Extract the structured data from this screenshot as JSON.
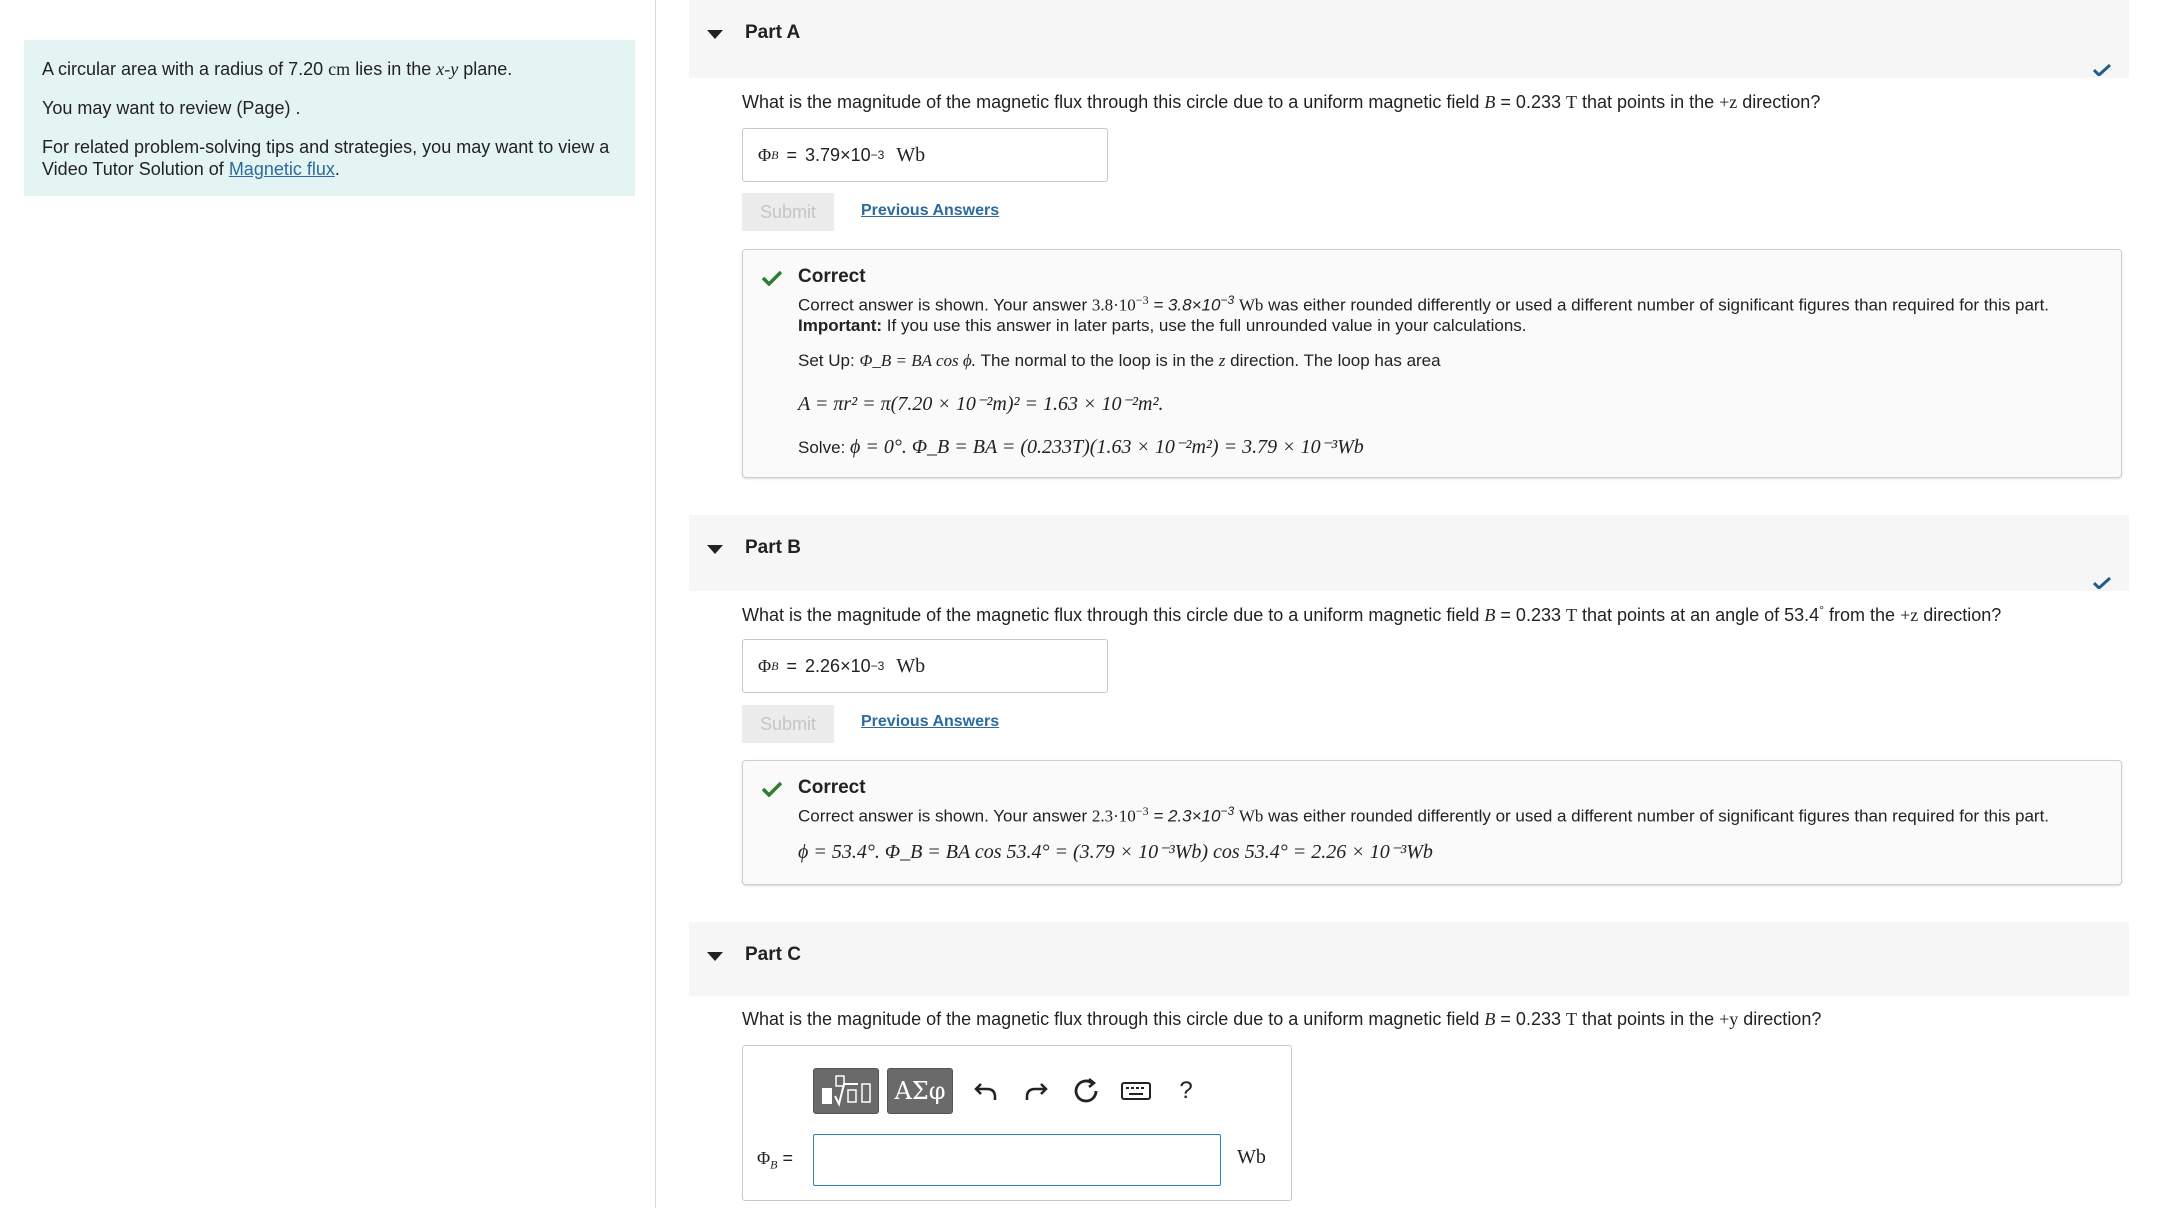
{
  "problem": {
    "line1_pre": "A circular area with a radius of 7.20",
    "line1_unit": "cm",
    "line1_mid": "lies in the",
    "line1_plane": "x-y",
    "line1_post": "plane.",
    "review": "You may want to review (Page) .",
    "tips_pre": "For related problem-solving tips and strategies, you may want to view a Video Tutor Solution of",
    "tips_link": "Magnetic flux",
    "tips_post": "."
  },
  "parts": [
    {
      "title": "Part A",
      "question_pre": "What is the magnitude of the magnetic flux through this circle due to a uniform magnetic field",
      "question_var": "B",
      "question_val": "= 0.233",
      "question_unit": "T",
      "question_post": "that points in the",
      "question_dir": "+z",
      "question_end": "direction?",
      "answer_label": "Φ",
      "answer_sub": "B",
      "answer_value": "3.79×10",
      "answer_exp": "−3",
      "answer_unit": "Wb",
      "submit_label": "Submit",
      "prev_label": "Previous Answers",
      "feedback_title": "Correct",
      "fb_line1_pre": "Correct answer is shown. Your answer",
      "fb_line1_val": "3.8·10",
      "fb_line1_exp": "−3",
      "fb_line1_eq": "= 3.8×10",
      "fb_line1_eq_exp": "−3",
      "fb_line1_unit": "Wb",
      "fb_line1_post": "was either rounded differently or used a different number of significant figures than required for this part.",
      "fb_important_label": "Important:",
      "fb_important_text": "If you use this answer in later parts, use the full unrounded value in your calculations.",
      "fb_setup_label": "Set Up:",
      "fb_setup_eq": "Φ_B = BA cos ϕ.",
      "fb_setup_text": "The normal to the loop is in the",
      "fb_setup_var": "z",
      "fb_setup_text2": "direction. The loop has area",
      "fb_area_eq": "A = πr² = π(7.20 × 10⁻²m)² = 1.63 × 10⁻²m².",
      "fb_solve_label": "Solve:",
      "fb_solve_eq": "ϕ = 0°. Φ_B = BA = (0.233T)(1.63 × 10⁻²m²) = 3.79 × 10⁻³Wb"
    },
    {
      "title": "Part B",
      "question_pre": "What is the magnitude of the magnetic flux through this circle due to a uniform magnetic field",
      "question_var": "B",
      "question_val": "= 0.233",
      "question_unit": "T",
      "question_post": "that points at an angle of 53.4",
      "question_deg": "°",
      "question_post2": "from the",
      "question_dir": "+z",
      "question_end": "direction?",
      "answer_label": "Φ",
      "answer_sub": "B",
      "answer_value": "2.26×10",
      "answer_exp": "−3",
      "answer_unit": "Wb",
      "submit_label": "Submit",
      "prev_label": "Previous Answers",
      "feedback_title": "Correct",
      "fb_line1_pre": "Correct answer is shown. Your answer",
      "fb_line1_val": "2.3·10",
      "fb_line1_exp": "−3",
      "fb_line1_eq": "= 2.3×10",
      "fb_line1_eq_exp": "−3",
      "fb_line1_unit": "Wb",
      "fb_line1_post": "was either rounded differently or used a different number of significant figures than required for this part.",
      "fb_eq": "ϕ = 53.4°. Φ_B = BA cos 53.4° = (3.79 × 10⁻³Wb) cos 53.4° = 2.26 × 10⁻³Wb"
    },
    {
      "title": "Part C",
      "question_pre": "What is the magnitude of the magnetic flux through this circle due to a uniform magnetic field",
      "question_var": "B",
      "question_val": "= 0.233",
      "question_unit": "T",
      "question_post": "that points in the",
      "question_dir": "+y",
      "question_end": "direction?",
      "answer_label": "Φ",
      "answer_sub": "B",
      "answer_eq": "=",
      "answer_unit": "Wb",
      "toolbar": {
        "templates_icon": "fraction-root-template-icon",
        "greek_label": "ΑΣφ",
        "undo_icon": "undo-icon",
        "redo_icon": "redo-icon",
        "reset_icon": "reset-icon",
        "keyboard_icon": "keyboard-icon",
        "help_label": "?"
      }
    }
  ],
  "colors": {
    "problem_bg": "#e4f4f3",
    "link": "#2c6aa0",
    "check_blue": "#1f5f8b",
    "check_green": "#2e7d32",
    "part_header_bg": "#f6f6f6"
  }
}
